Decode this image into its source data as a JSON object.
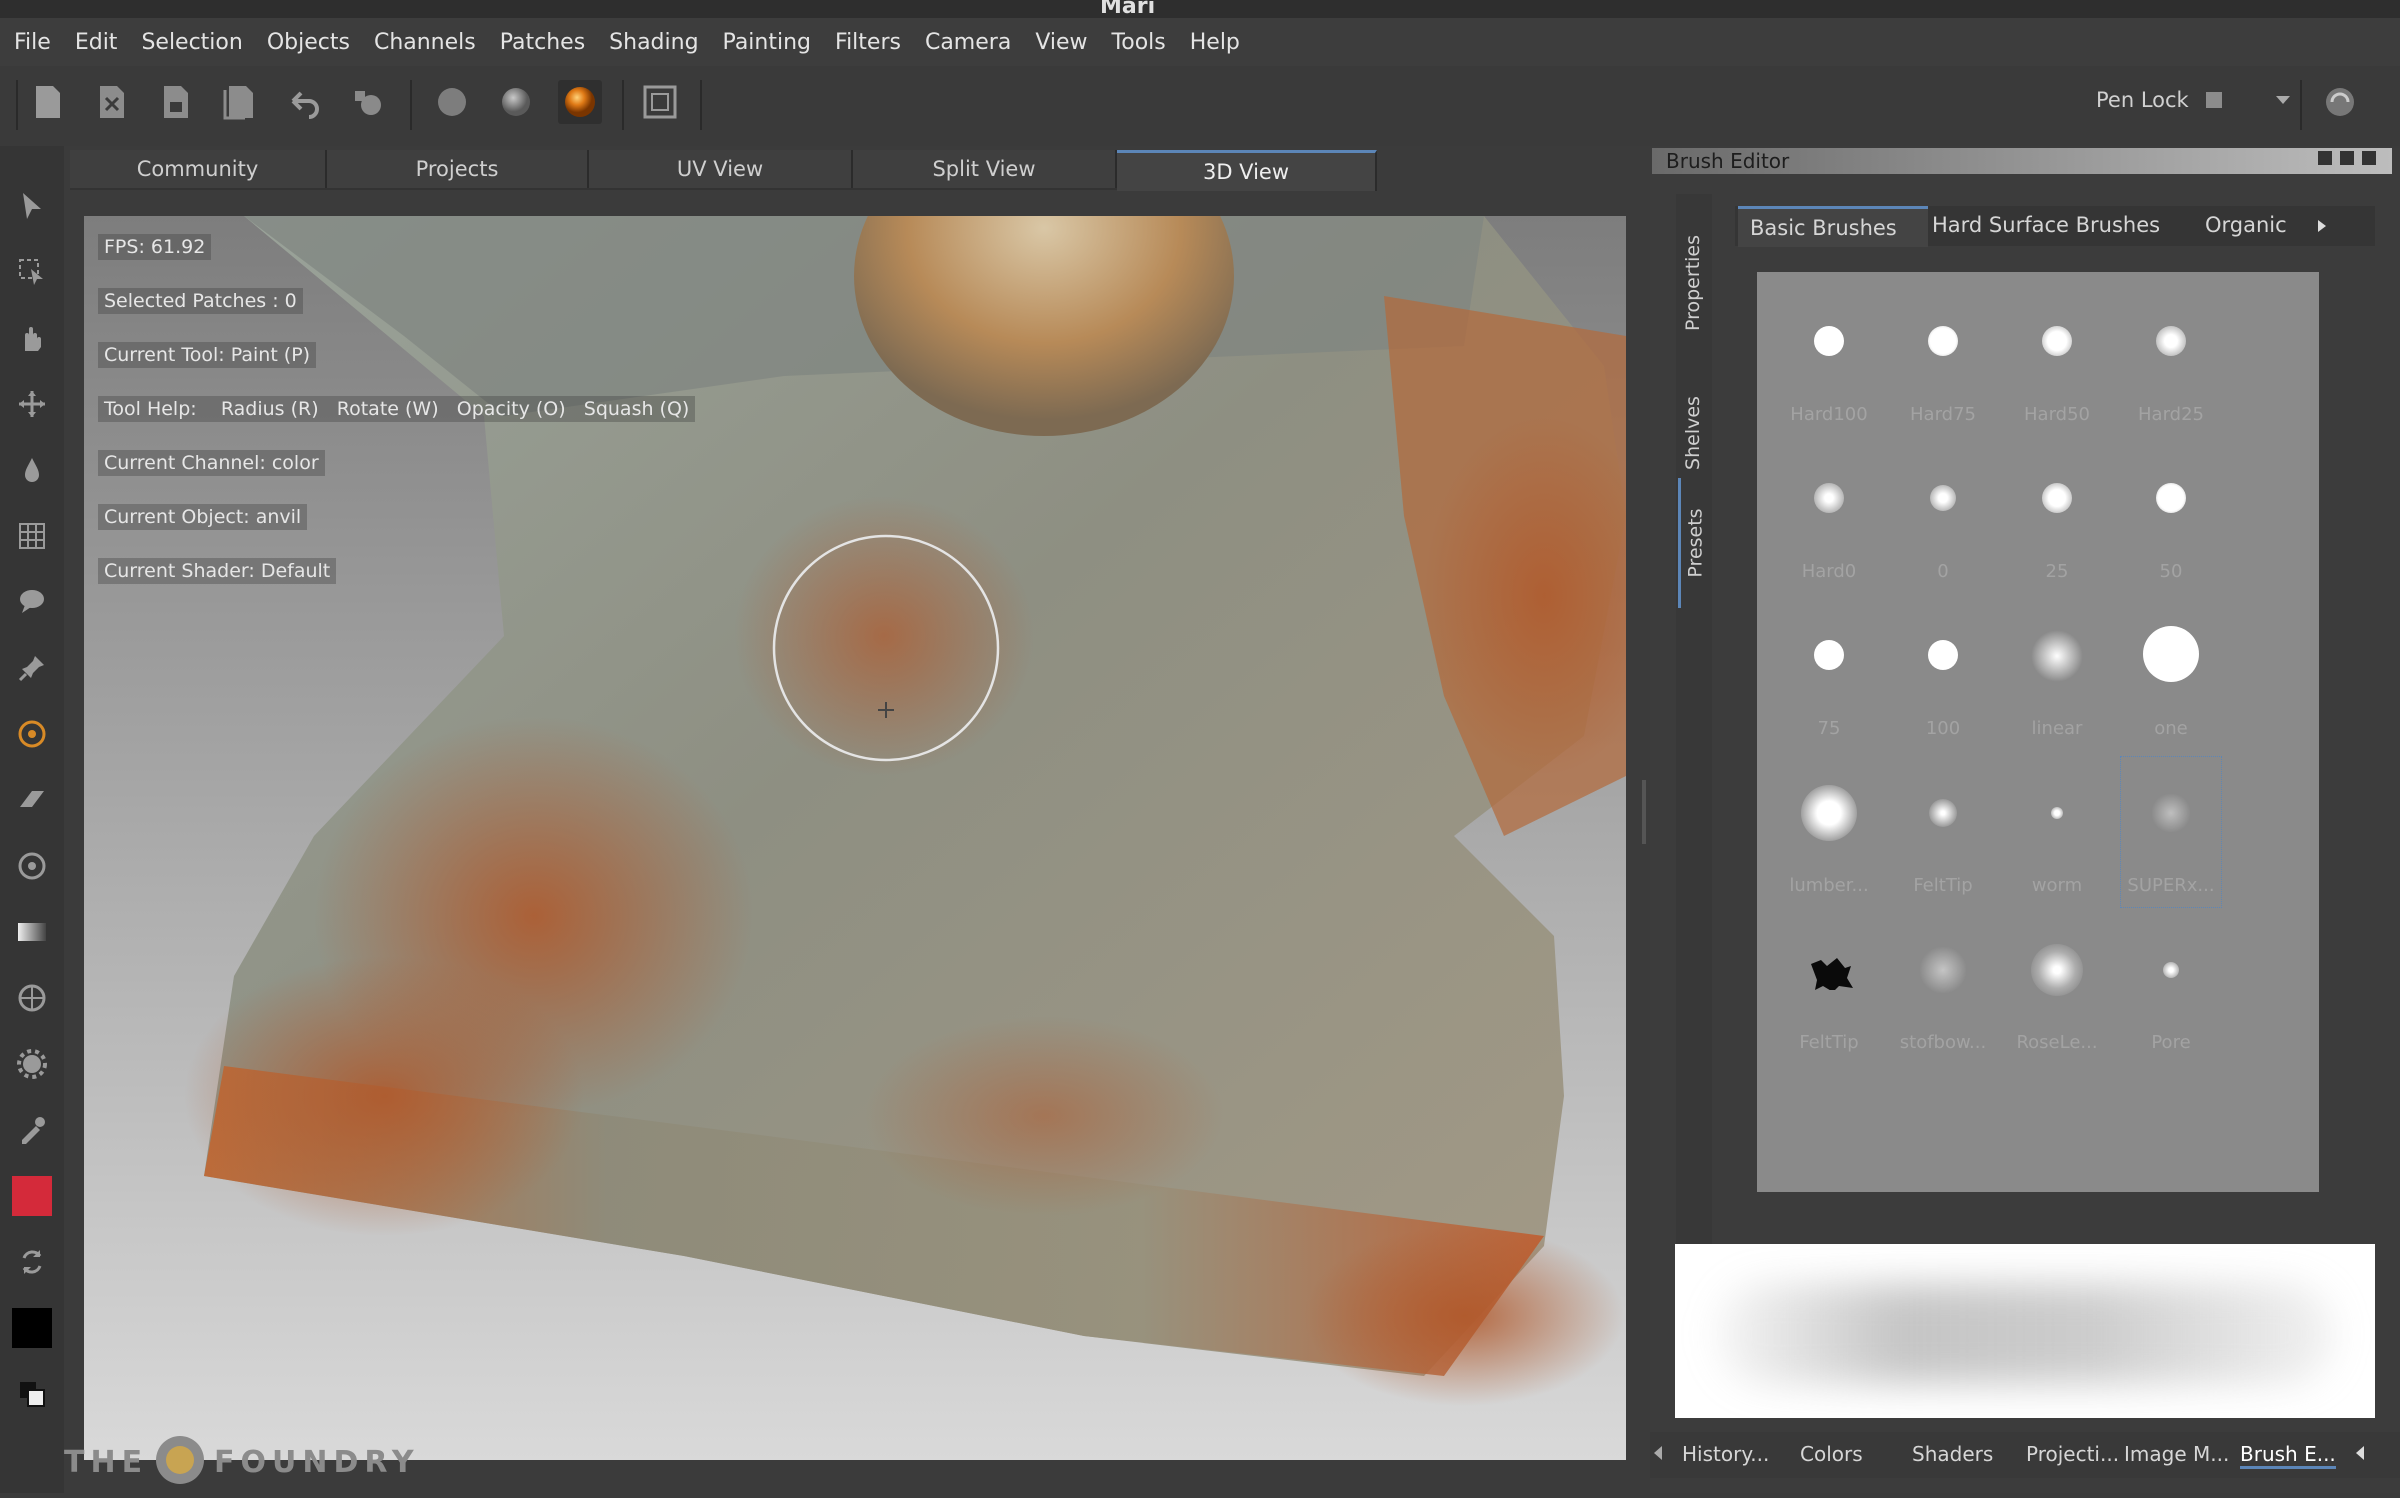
{
  "window": {
    "title": "Mari"
  },
  "menu": [
    "File",
    "Edit",
    "Selection",
    "Objects",
    "Channels",
    "Patches",
    "Shading",
    "Painting",
    "Filters",
    "Camera",
    "View",
    "Tools",
    "Help"
  ],
  "toolbar": {
    "pen_lock_label": "Pen Lock"
  },
  "view_tabs": [
    "Community",
    "Projects",
    "UV View",
    "Split View",
    "3D View"
  ],
  "active_view_tab": "3D View",
  "hud": {
    "fps": "FPS: 61.92",
    "selected_patches": "Selected Patches : 0",
    "current_tool": "Current Tool: Paint (P)",
    "tool_help_label": "Tool Help:",
    "tool_help_items": [
      "Radius (R)",
      "Rotate (W)",
      "Opacity (O)",
      "Squash (Q)"
    ],
    "current_channel": "Current Channel: color",
    "current_object": "Current Object: anvil",
    "current_shader": "Current Shader: Default"
  },
  "brush_editor": {
    "title": "Brush Editor",
    "side_tabs": [
      "Properties",
      "Shelves",
      "Presets"
    ],
    "tabs": [
      "Basic Brushes",
      "Hard Surface Brushes",
      "Organic"
    ],
    "brushes": [
      "Hard100",
      "Hard75",
      "Hard50",
      "Hard25",
      "Hard0",
      "0",
      "25",
      "50",
      "75",
      "100",
      "linear",
      "one",
      "lumber...",
      "FeltTip",
      "worm",
      "SUPERx...",
      "FeltTip",
      "stofbow...",
      "RoseLe...",
      "Pore"
    ]
  },
  "bottom_tabs": [
    "History...",
    "Colors",
    "Shaders",
    "Projecti...",
    "Image M...",
    "Brush E..."
  ],
  "watermark": "THE FOUNDRY",
  "colors": {
    "foreground": "#d42a3a",
    "background": "#000000",
    "accent": "#5c86b8"
  }
}
